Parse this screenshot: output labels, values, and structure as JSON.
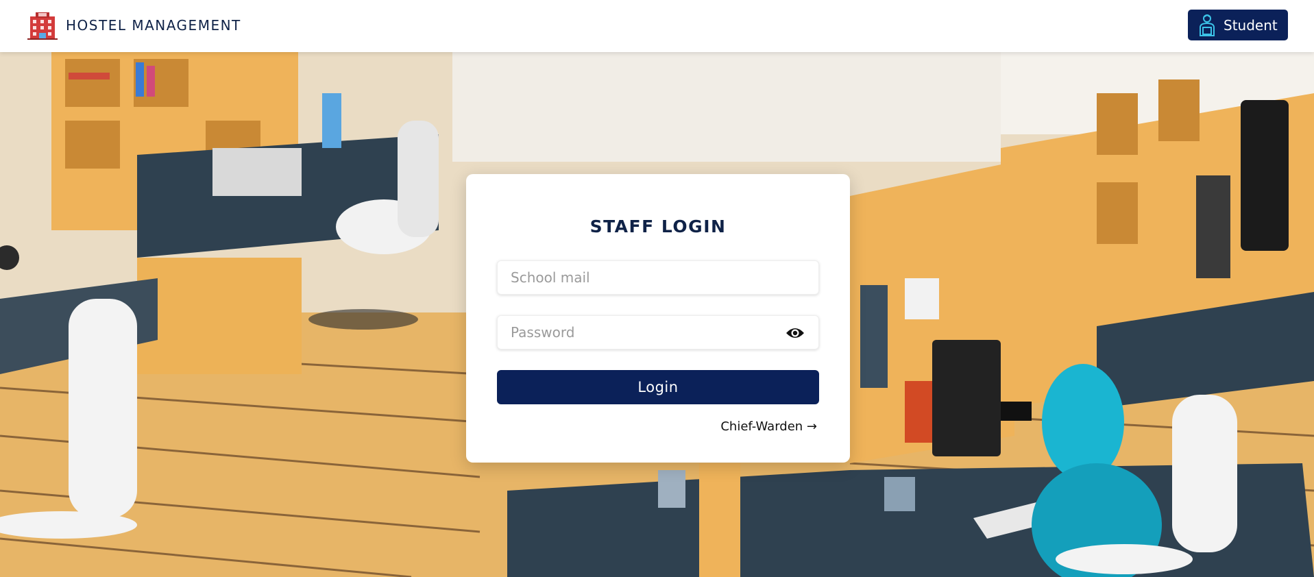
{
  "header": {
    "brand_title": "HOSTEL MANAGEMENT",
    "brand_icon": "hotel-building-icon",
    "student_button_label": "Student",
    "student_icon": "student-reading-icon"
  },
  "login_card": {
    "title": "STAFF LOGIN",
    "email_placeholder": "School mail",
    "password_placeholder": "Password",
    "password_toggle_icon": "eye-icon",
    "login_button_label": "Login",
    "chief_warden_link": "Chief-Warden →"
  },
  "colors": {
    "primary": "#0b2159",
    "background_wood": "#e9b35b",
    "desk_top": "#2f4150"
  }
}
